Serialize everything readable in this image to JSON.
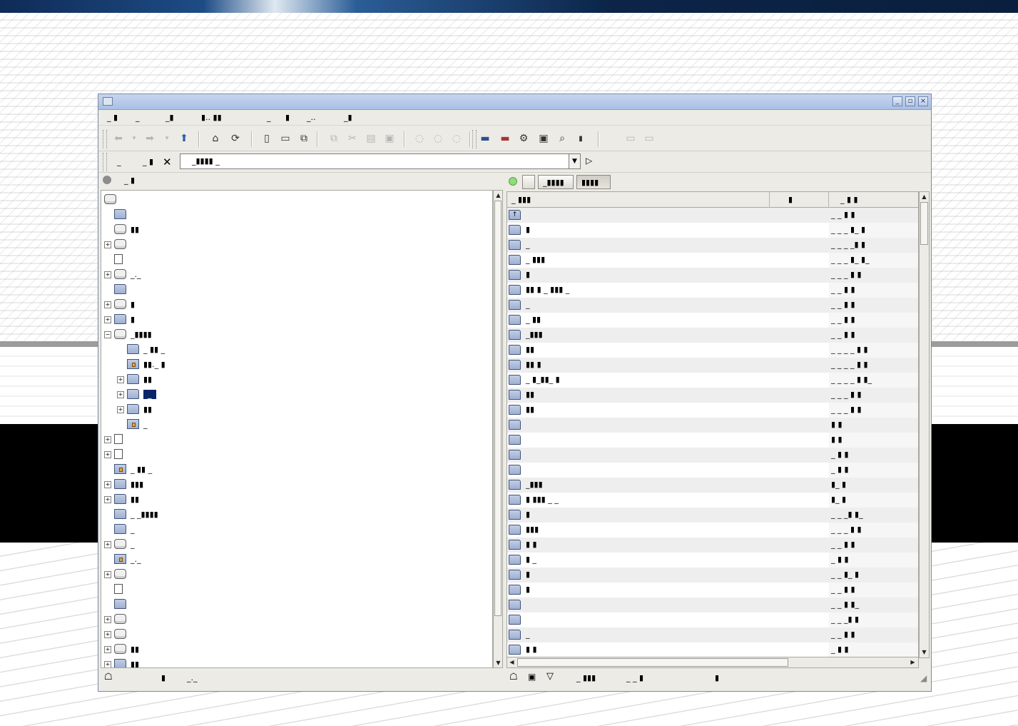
{
  "window": {
    "title": ""
  },
  "menu": [
    "_ ▮",
    "_",
    "_▮",
    "▮.. ▮▮",
    "_",
    "▮",
    "_..",
    "_▮"
  ],
  "location": {
    "label1": "_",
    "label2": "_ ▮",
    "value": "_▮▮▮▮  _"
  },
  "left_pane": {
    "header": "_ ▮",
    "tree": [
      {
        "type": "drive",
        "label": "",
        "indent": 0,
        "expander": false
      },
      {
        "type": "folder",
        "label": "",
        "indent": 1,
        "expander": false
      },
      {
        "type": "drive",
        "label": "▮▮",
        "indent": 1,
        "expander": false
      },
      {
        "type": "drive",
        "label": "",
        "indent": 1,
        "expander": "+"
      },
      {
        "type": "doc",
        "label": "",
        "indent": 1,
        "expander": false
      },
      {
        "type": "drive",
        "label": "_._",
        "indent": 1,
        "expander": "+"
      },
      {
        "type": "folder",
        "label": "",
        "indent": 1,
        "expander": false
      },
      {
        "type": "drive",
        "label": "▮",
        "indent": 1,
        "expander": "+"
      },
      {
        "type": "folder",
        "label": "▮",
        "indent": 1,
        "expander": "+"
      },
      {
        "type": "drive",
        "label": "_▮▮▮▮",
        "indent": 1,
        "expander": "−"
      },
      {
        "type": "folder",
        "label": "_  ▮▮ _",
        "indent": 2,
        "expander": false
      },
      {
        "type": "lfolder",
        "label": "▮▮._   ▮",
        "indent": 2,
        "expander": false
      },
      {
        "type": "folder",
        "label": "▮▮",
        "indent": 2,
        "expander": "+"
      },
      {
        "type": "folder",
        "label": "_",
        "indent": 2,
        "expander": "+",
        "selected": true
      },
      {
        "type": "folder",
        "label": "▮▮",
        "indent": 2,
        "expander": "+"
      },
      {
        "type": "lfolder",
        "label": "_",
        "indent": 2,
        "expander": false
      },
      {
        "type": "doc",
        "label": "",
        "indent": 1,
        "expander": "+"
      },
      {
        "type": "doc",
        "label": "",
        "indent": 1,
        "expander": "+"
      },
      {
        "type": "lfolder",
        "label": "_  ▮▮ _",
        "indent": 1,
        "expander": false
      },
      {
        "type": "folder",
        "label": "▮▮▮",
        "indent": 1,
        "expander": "+"
      },
      {
        "type": "folder",
        "label": "▮▮",
        "indent": 1,
        "expander": "+"
      },
      {
        "type": "folder",
        "label": "_   _▮▮▮▮",
        "indent": 1,
        "expander": false
      },
      {
        "type": "folder",
        "label": "_",
        "indent": 1,
        "expander": false
      },
      {
        "type": "drive",
        "label": "_",
        "indent": 1,
        "expander": "+"
      },
      {
        "type": "lfolder",
        "label": "_._",
        "indent": 1,
        "expander": false
      },
      {
        "type": "drive",
        "label": "",
        "indent": 1,
        "expander": "+"
      },
      {
        "type": "doc",
        "label": "",
        "indent": 1,
        "expander": false
      },
      {
        "type": "folder",
        "label": "",
        "indent": 1,
        "expander": false
      },
      {
        "type": "drive",
        "label": "",
        "indent": 1,
        "expander": "+"
      },
      {
        "type": "drive",
        "label": "",
        "indent": 1,
        "expander": "+"
      },
      {
        "type": "drive",
        "label": "▮▮",
        "indent": 1,
        "expander": "+"
      },
      {
        "type": "folder",
        "label": "▮▮",
        "indent": 1,
        "expander": "+"
      }
    ],
    "status": {
      "count": "▮",
      "text": "_._"
    }
  },
  "right_pane": {
    "tabs": [
      "",
      "_▮▮▮▮",
      "▮▮▮▮"
    ],
    "columns": [
      "_ ▮▮▮",
      "▮",
      "_ ▮  ▮"
    ],
    "rows": [
      {
        "name": "",
        "size": "",
        "date": "_   _ ▮ ▮",
        "up": true
      },
      {
        "name": "  ▮",
        "size": "",
        "date": "_ _  _ ▮_ ▮"
      },
      {
        "name": "_",
        "size": "",
        "date": "_ _  _ _▮ ▮"
      },
      {
        "name": "_  ▮▮▮",
        "size": "",
        "date": "_ _  _ ▮_ ▮_"
      },
      {
        "name": " ▮",
        "size": "",
        "date": "_   _ _ ▮ ▮"
      },
      {
        "name": "▮▮   ▮ _  ▮▮▮  _",
        "size": "",
        "date": "_   _  ▮ ▮"
      },
      {
        "name": "_",
        "size": "",
        "date": "_   _  ▮ ▮"
      },
      {
        "name": "      _ ▮▮",
        "size": "",
        "date": "_   _  ▮ ▮"
      },
      {
        "name": " _▮▮▮",
        "size": "",
        "date": "_   _  ▮ ▮"
      },
      {
        "name": "  ▮▮",
        "size": "",
        "date": "_ _  _ _ ▮ ▮"
      },
      {
        "name": "  ▮▮      ▮",
        "size": "",
        "date": "_ _  _ _ ▮ ▮"
      },
      {
        "name": "_ ▮_▮▮_  ▮",
        "size": "",
        "date": "_ _  _ _ ▮ ▮_"
      },
      {
        "name": "▮▮",
        "size": "",
        "date": "_ _  _  ▮ ▮"
      },
      {
        "name": "  ▮▮",
        "size": "",
        "date": "_ _  _  ▮ ▮"
      },
      {
        "name": "",
        "size": "",
        "date": "           ▮ ▮"
      },
      {
        "name": "",
        "size": "",
        "date": "           ▮ ▮"
      },
      {
        "name": "",
        "size": "",
        "date": "_          ▮ ▮"
      },
      {
        "name": "",
        "size": "",
        "date": "_          ▮ ▮"
      },
      {
        "name": " _▮▮▮",
        "size": "",
        "date": "           ▮_ ▮"
      },
      {
        "name": "  ▮ ▮▮▮ _ _",
        "size": "",
        "date": "           ▮_ ▮"
      },
      {
        "name": "    ▮",
        "size": "",
        "date": "_ _   _▮ ▮_"
      },
      {
        "name": " ▮▮▮",
        "size": "",
        "date": "_  _   _ ▮ ▮"
      },
      {
        "name": " ▮    ▮",
        "size": "",
        "date": "_ _       ▮ ▮"
      },
      {
        "name": " ▮  _",
        "size": "",
        "date": "  _       ▮ ▮"
      },
      {
        "name": "  ▮",
        "size": "",
        "date": "_ _       ▮_ ▮"
      },
      {
        "name": "▮",
        "size": "",
        "date": "  _    _ ▮ ▮"
      },
      {
        "name": "",
        "size": "",
        "date": "_ _       ▮ ▮_"
      },
      {
        "name": "",
        "size": "",
        "date": "_ _   _▮ ▮"
      },
      {
        "name": "_",
        "size": "",
        "date": "_ _       ▮ ▮"
      },
      {
        "name": "▮    ▮",
        "size": "",
        "date": "  _       ▮ ▮"
      }
    ],
    "status": {
      "text1": "_ ▮▮▮",
      "text2": "_  _  ▮",
      "text3": "▮"
    }
  },
  "toolbar_icons": [
    "back-icon",
    "back-dropdown-icon",
    "forward-icon",
    "forward-dropdown-icon",
    "up-icon",
    "home-icon",
    "reload-icon",
    "new-file-icon",
    "open-folder-icon",
    "copy-to-icon",
    "copy-icon",
    "cut-icon",
    "paste-icon",
    "paste-into-icon",
    "delete-icon",
    "shred-icon",
    "trash-icon",
    "network-folder-icon",
    "remove-network-icon",
    "settings-icon",
    "terminal-icon",
    "find-icon",
    "views-icon",
    "bookmark-a-icon",
    "bookmark-b-icon"
  ],
  "colors": {
    "selection": "#0a246a",
    "titlebar": "#a9bfe3",
    "folder": "#9eb0d3"
  }
}
